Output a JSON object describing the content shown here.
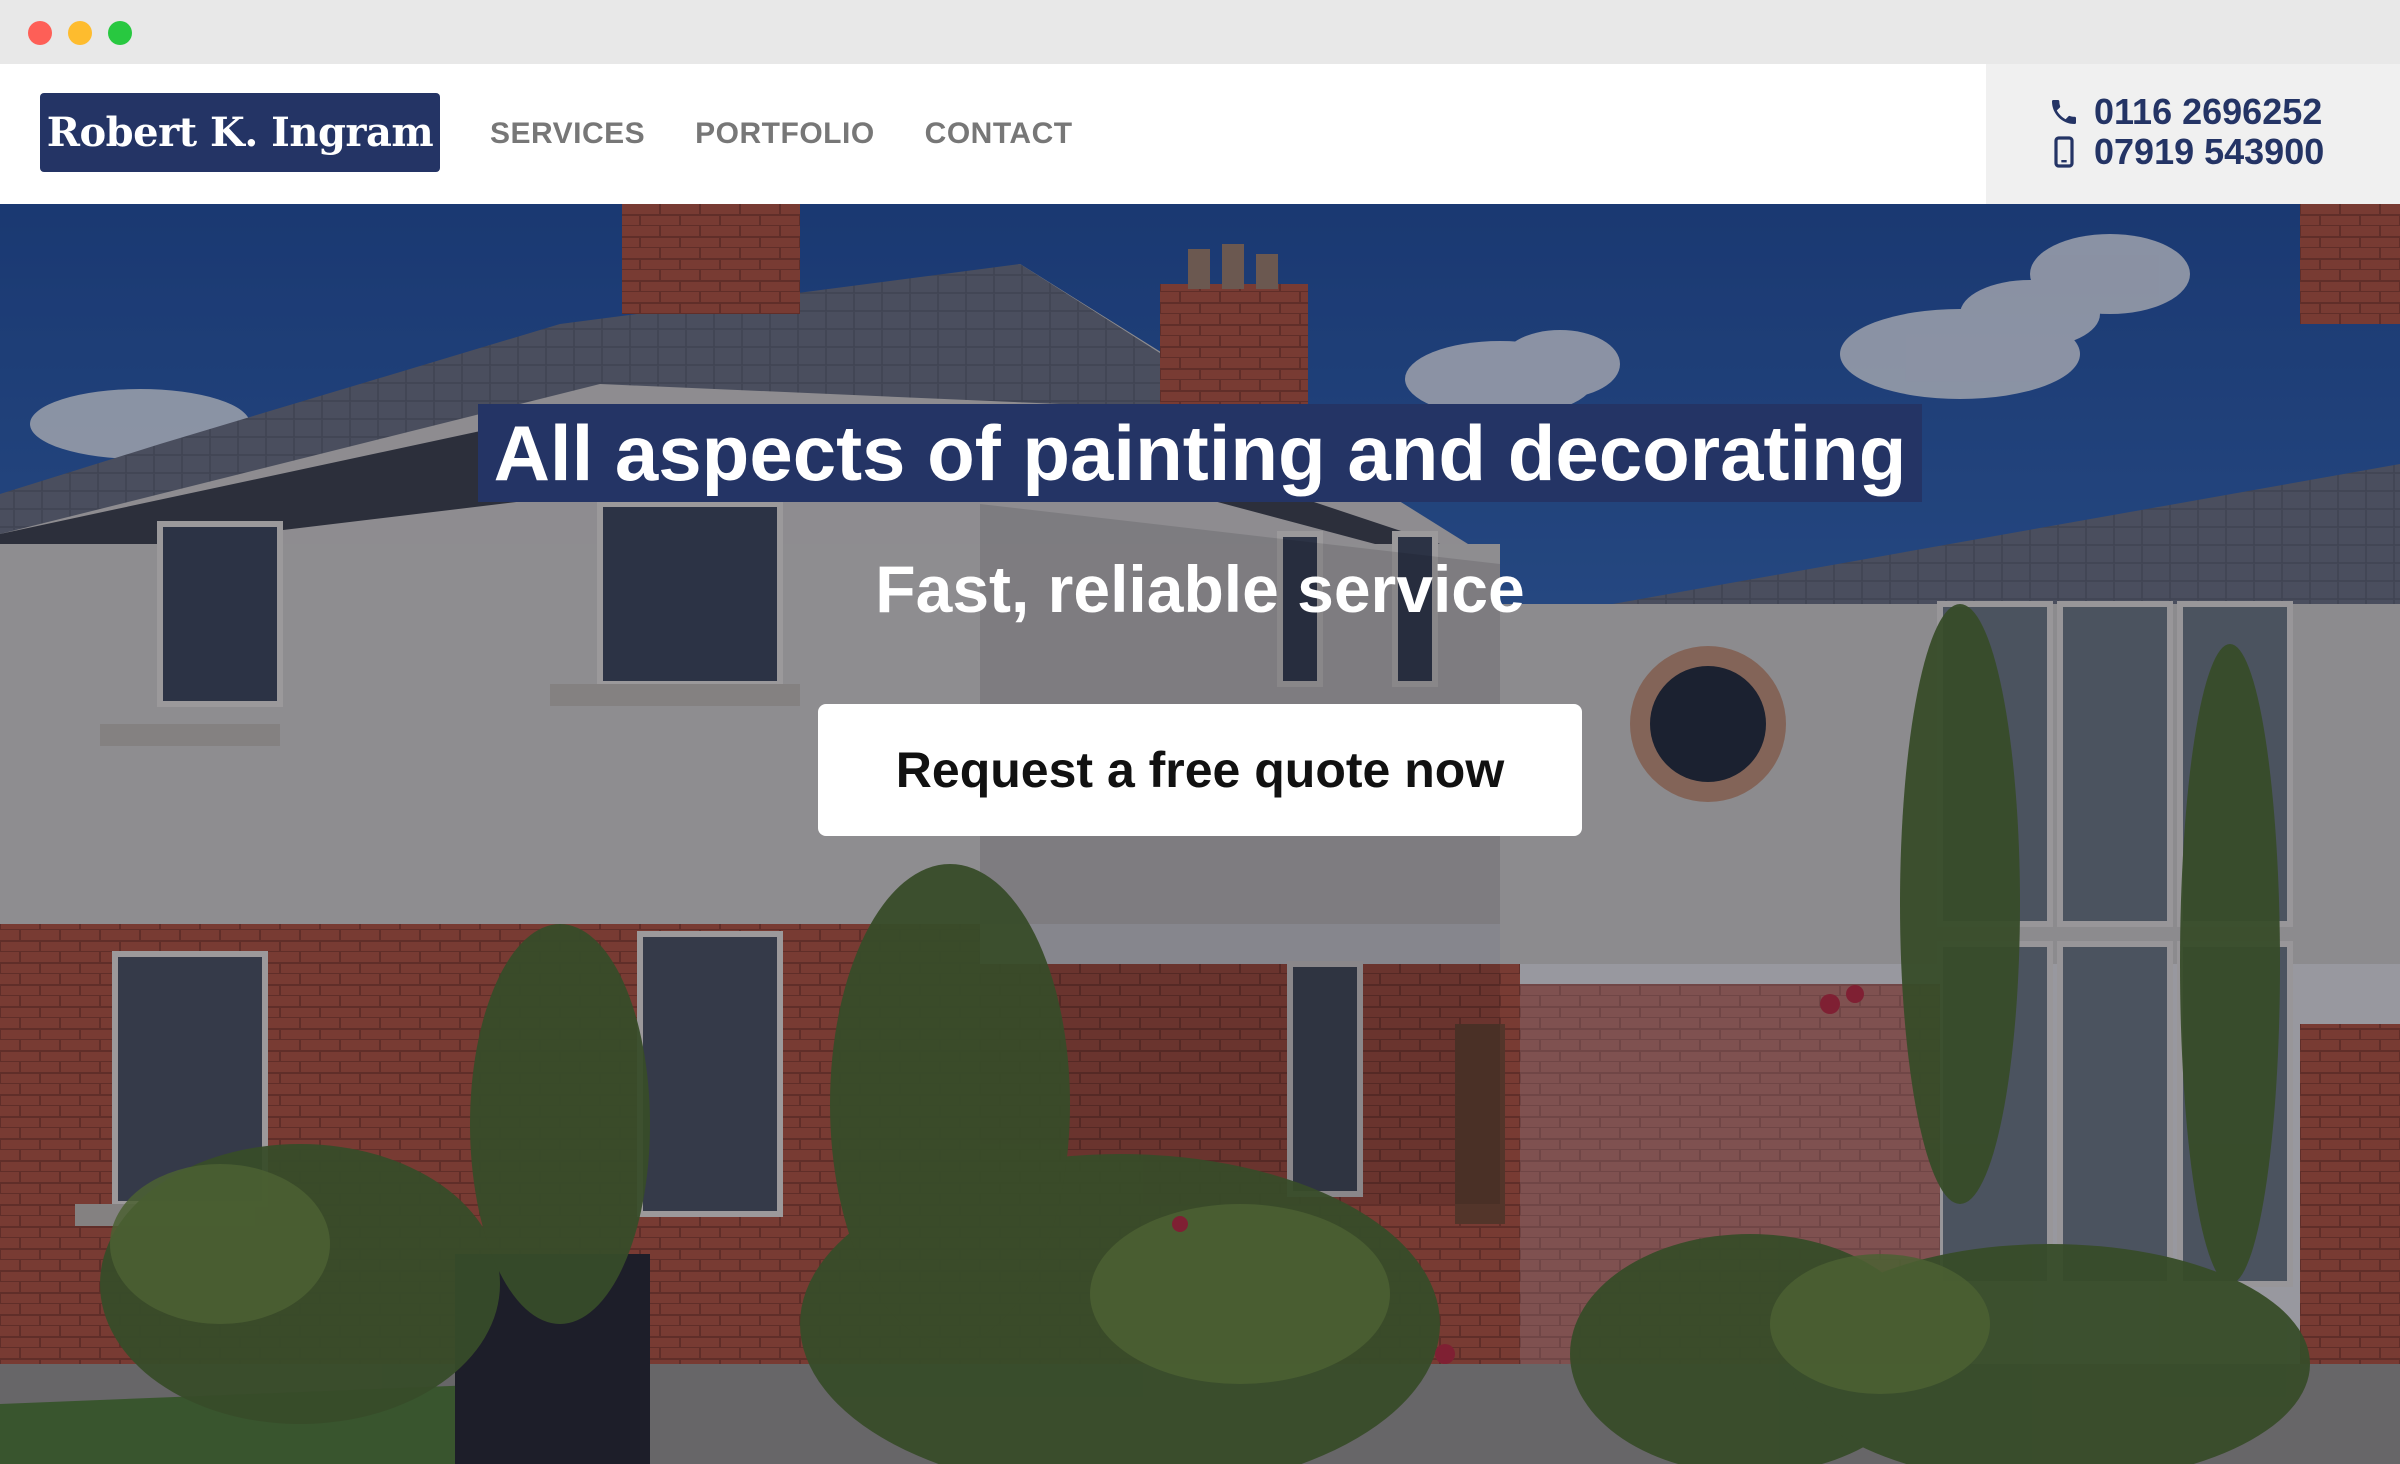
{
  "window": {
    "controls": [
      "close",
      "minimize",
      "maximize"
    ]
  },
  "header": {
    "logo_text": "Robert K. Ingram",
    "nav": [
      {
        "label": "SERVICES"
      },
      {
        "label": "PORTFOLIO"
      },
      {
        "label": "CONTACT"
      }
    ],
    "phones": [
      {
        "icon": "phone-icon",
        "number": "0116 2696252"
      },
      {
        "icon": "mobile-icon",
        "number": "07919 543900"
      }
    ]
  },
  "hero": {
    "headline": "All aspects of painting and decorating",
    "subheadline": "Fast, reliable service",
    "cta_label": "Request a free quote now"
  },
  "colors": {
    "brand_navy": "#243465",
    "nav_grey": "#777777",
    "phone_panel": "#f0f0f0"
  }
}
